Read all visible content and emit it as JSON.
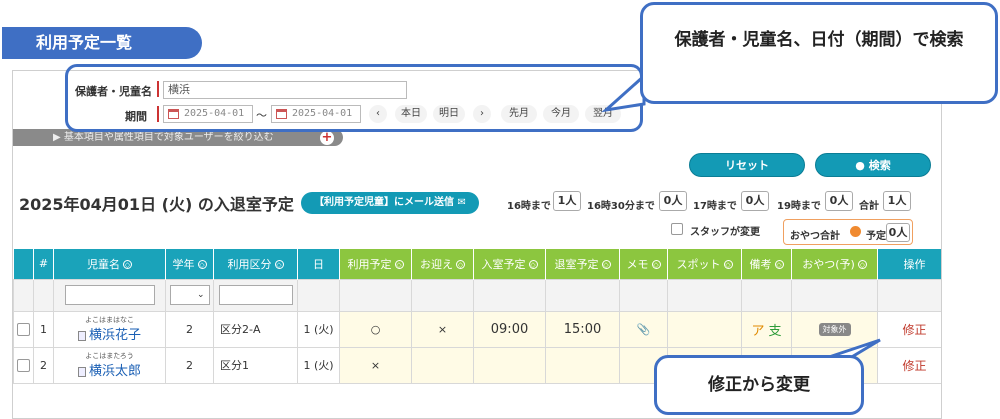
{
  "page_title": "利用予定一覧",
  "search": {
    "guardian_label": "保護者・児童名",
    "guardian_value": "横浜",
    "period_label": "期間",
    "date_from": "2025-04-01",
    "separator": "～",
    "date_to": "2025-04-01",
    "prev": "‹",
    "today": "本日",
    "tomorrow": "明日",
    "next": "›",
    "last_month": "先月",
    "this_month": "今月",
    "next_month": "翌月"
  },
  "filter_bar": {
    "label": "▶ 基本項目や属性項目で対象ユーザーを絞り込む",
    "plus": "+"
  },
  "buttons": {
    "reset": "リセット",
    "search": "● 検索"
  },
  "heading": {
    "date_title": "2025年04月01日 (火) の入退室予定",
    "mail_button": "【利用予定児童】にメール送信 ✉"
  },
  "counts": [
    {
      "label": "16時まで",
      "value": "1人"
    },
    {
      "label": "16時30分まで",
      "value": "0人"
    },
    {
      "label": "17時まで",
      "value": "0人"
    },
    {
      "label": "19時まで",
      "value": "0人"
    },
    {
      "label": "合計",
      "value": "1人"
    }
  ],
  "staff_changed_label": "スタッフが変更",
  "oyatsu": {
    "total_label": "おやつ合計",
    "yotei_label": "予定",
    "count": "0人"
  },
  "table": {
    "headers": {
      "num": "#",
      "child": "児童名",
      "grade": "学年",
      "usage": "利用区分",
      "day": "日",
      "plan": "利用予定",
      "pickup": "お迎え",
      "entry": "入室予定",
      "exit": "退室予定",
      "memo": "メモ",
      "spot": "スポット",
      "remarks": "備考",
      "snack": "おやつ(予)",
      "action": "操作"
    },
    "sort_icon": "◇",
    "rows": [
      {
        "num": "1",
        "kana": "よこはまはなこ",
        "name": "横浜花子",
        "grade": "2",
        "usage": "区分2-A",
        "day": "1 (火)",
        "plan": "○",
        "pickup": "×",
        "entry": "09:00",
        "exit": "15:00",
        "memo": "📎",
        "remark_a": "ア",
        "remark_b": "支",
        "snack": "対象外",
        "action": "修正"
      },
      {
        "num": "2",
        "kana": "よこはまたろう",
        "name": "横浜太郎",
        "grade": "2",
        "usage": "区分1",
        "day": "1 (火)",
        "plan": "×",
        "pickup": "",
        "entry": "",
        "exit": "",
        "memo": "",
        "remark_a": "",
        "remark_b": "",
        "snack": "",
        "action": "修正"
      }
    ]
  },
  "callouts": {
    "search": "保護者・児童名、日付（期間）で検索",
    "edit": "修正から変更"
  },
  "colors": {
    "primary_blue": "#3f6fc4",
    "teal": "#1aa3ba",
    "green_header": "#8cc63f",
    "edit_red": "#c0392b"
  }
}
